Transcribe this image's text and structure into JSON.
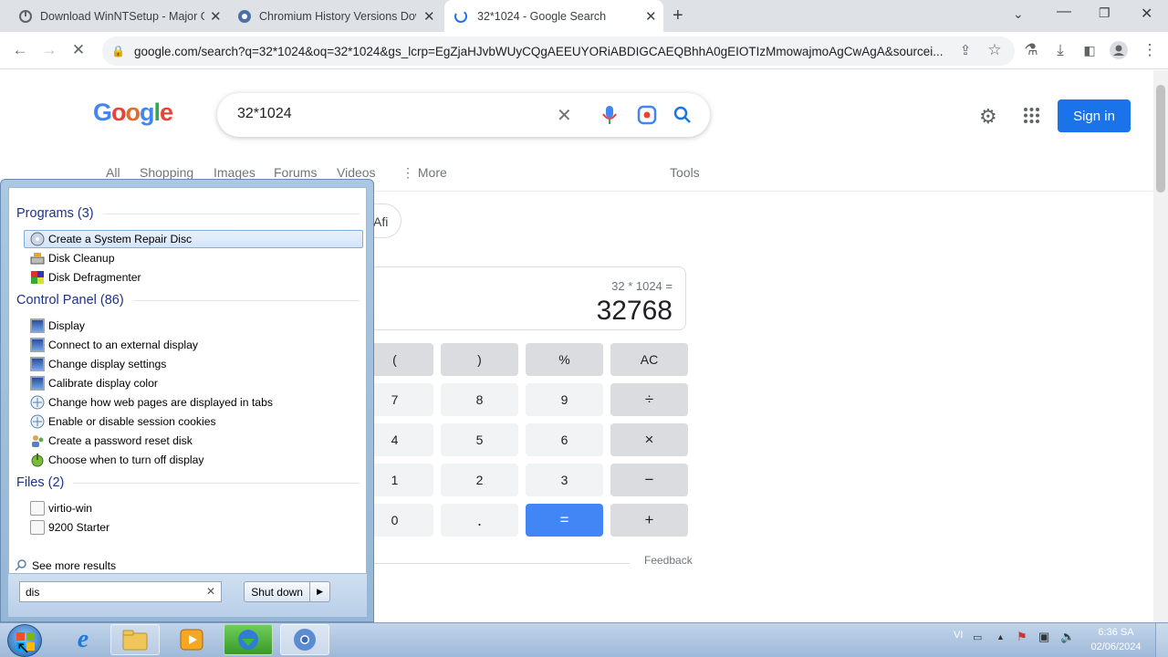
{
  "browser": {
    "tabs": [
      {
        "title": "Download WinNTSetup - Major Geeks",
        "active": false
      },
      {
        "title": "Chromium History Versions Download",
        "active": false
      },
      {
        "title": "32*1024 - Google Search",
        "active": true
      }
    ],
    "url": "google.com/search?q=32*1024&oq=32*1024&gs_lcrp=EgZjaHJvbWUyCQgAEEUYORiABDIGCAEQBhhA0gEIOTIzMmowajmoAgCwAgA&sourcei..."
  },
  "google": {
    "query": "32*1024",
    "sign_in": "Sign in",
    "nav": [
      "All",
      "Shopping",
      "Images",
      "Forums",
      "Videos",
      "More",
      "Tools"
    ],
    "chip_partial": "Afi",
    "calculator": {
      "expression": "32 * 1024 =",
      "result": "32768",
      "keys": [
        [
          "(",
          ")",
          "%",
          "AC"
        ],
        [
          "7",
          "8",
          "9",
          "÷"
        ],
        [
          "4",
          "5",
          "6",
          "×"
        ],
        [
          "1",
          "2",
          "3",
          "−"
        ],
        [
          "0",
          ".",
          "=",
          "+"
        ]
      ],
      "feedback": "Feedback"
    }
  },
  "start_menu": {
    "programs_header": "Programs (3)",
    "programs": [
      "Create a System Repair Disc",
      "Disk Cleanup",
      "Disk Defragmenter"
    ],
    "control_panel_header": "Control Panel (86)",
    "control_panel": [
      "Display",
      "Connect to an external display",
      "Change display settings",
      "Calibrate display color",
      "Change how web pages are displayed in tabs",
      "Enable or disable session cookies",
      "Create a password reset disk",
      "Choose when to turn off display"
    ],
    "files_header": "Files (2)",
    "files": [
      "virtio-win",
      "9200 Starter"
    ],
    "see_more": "See more results",
    "search_value": "dis",
    "shutdown": "Shut down"
  },
  "taskbar": {
    "lang": "VI",
    "time": "6:36 SA",
    "date": "02/06/2024"
  }
}
